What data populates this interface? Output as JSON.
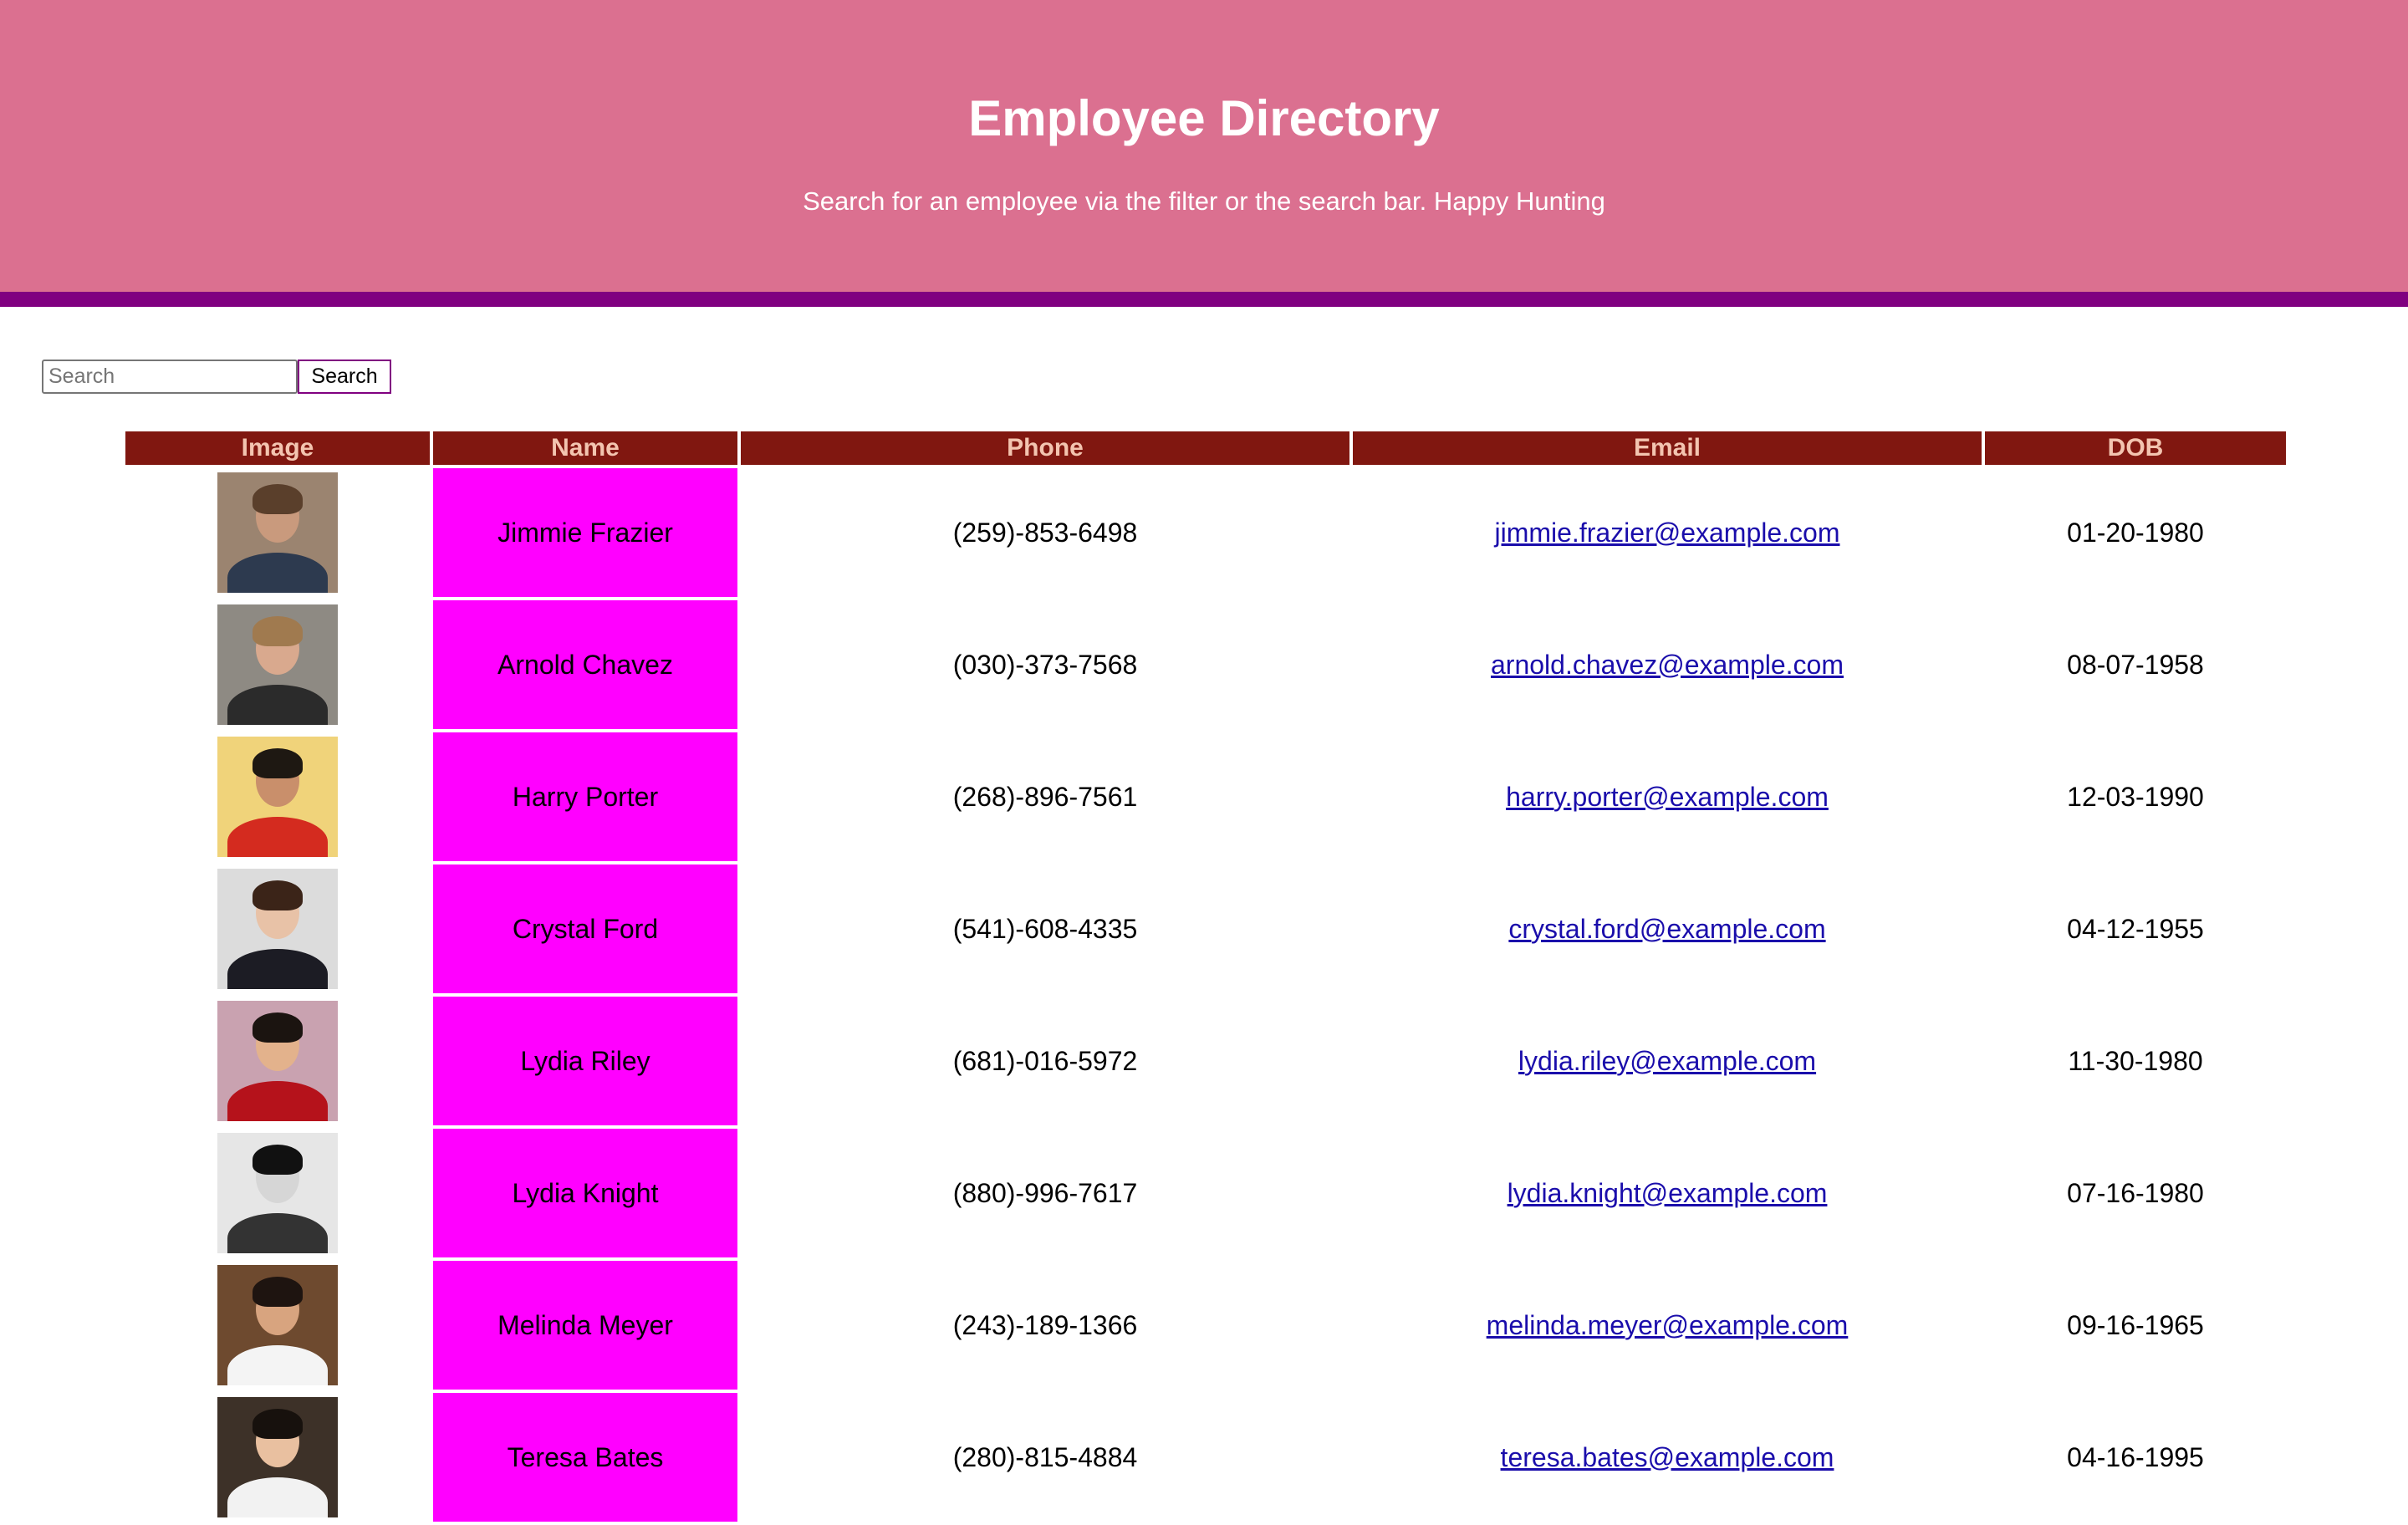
{
  "header": {
    "title": "Employee Directory",
    "subtitle": "Search for an employee via the filter or the search bar. Happy Hunting"
  },
  "search": {
    "placeholder": "Search",
    "value": "",
    "button_label": "Search"
  },
  "table": {
    "columns": [
      "Image",
      "Name",
      "Phone",
      "Email",
      "DOB"
    ],
    "rows": [
      {
        "name": "Jimmie Frazier",
        "phone": "(259)-853-6498",
        "email": "jimmie.frazier@example.com",
        "dob": "01-20-1980"
      },
      {
        "name": "Arnold Chavez",
        "phone": "(030)-373-7568",
        "email": "arnold.chavez@example.com",
        "dob": "08-07-1958"
      },
      {
        "name": "Harry Porter",
        "phone": "(268)-896-7561",
        "email": "harry.porter@example.com",
        "dob": "12-03-1990"
      },
      {
        "name": "Crystal Ford",
        "phone": "(541)-608-4335",
        "email": "crystal.ford@example.com",
        "dob": "04-12-1955"
      },
      {
        "name": "Lydia Riley",
        "phone": "(681)-016-5972",
        "email": "lydia.riley@example.com",
        "dob": "11-30-1980"
      },
      {
        "name": "Lydia Knight",
        "phone": "(880)-996-7617",
        "email": "lydia.knight@example.com",
        "dob": "07-16-1980"
      },
      {
        "name": "Melinda Meyer",
        "phone": "(243)-189-1366",
        "email": "melinda.meyer@example.com",
        "dob": "09-16-1965"
      },
      {
        "name": "Teresa Bates",
        "phone": "(280)-815-4884",
        "email": "teresa.bates@example.com",
        "dob": "04-16-1995"
      }
    ]
  },
  "colors": {
    "header_bg": "#db7090",
    "header_border": "#800080",
    "table_header_bg": "#801710",
    "table_header_text": "#f3c4b0",
    "name_cell_bg": "#ff00ff",
    "link": "#1a0dab"
  }
}
